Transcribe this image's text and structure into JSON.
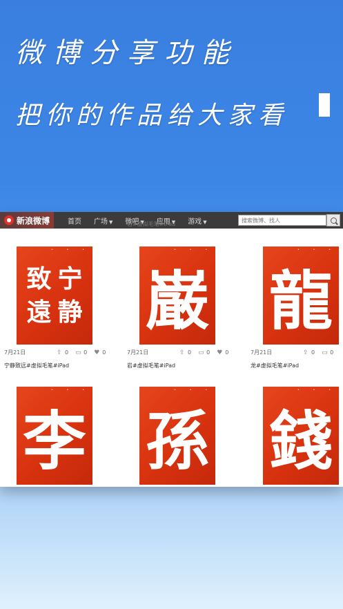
{
  "hero": {
    "headline": "微博分享功能",
    "subheadline": "把你的作品给大家看"
  },
  "weibo": {
    "logo_text": "新浪微博",
    "nav": [
      {
        "label": "首页",
        "has_caret": false
      },
      {
        "label": "广场",
        "has_caret": true
      },
      {
        "label": "微吧",
        "has_caret": true
      },
      {
        "label": "应用",
        "has_caret": true
      },
      {
        "label": "游戏",
        "has_caret": true
      }
    ],
    "search_placeholder": "搜索微博、找人",
    "ghost_text": "岩#虚拟毛笔#iPad"
  },
  "posts": [
    {
      "glyph": [
        "致",
        "宁",
        "遠",
        "静"
      ],
      "date": "7月21日",
      "share_count": "0",
      "comment_count": "0",
      "like_count": "0",
      "caption": "宁静致远#虚拟毛笔#iPad"
    },
    {
      "glyph": [
        "巌"
      ],
      "date": "7月21日",
      "share_count": "0",
      "comment_count": "0",
      "like_count": "0",
      "caption": "岩#虚拟毛笔#iPad"
    },
    {
      "glyph": [
        "龍"
      ],
      "date": "7月21日",
      "share_count": "0",
      "comment_count": "0",
      "like_count": "0",
      "caption": "龙#虚拟毛笔#iPad"
    },
    {
      "glyph": [
        "李"
      ]
    },
    {
      "glyph": [
        "孫"
      ]
    },
    {
      "glyph": [
        "錢"
      ]
    }
  ],
  "colors": {
    "artwork_red": "#d8320f",
    "topbar": "#3b3b3b",
    "sky_blue": "#3c86e6"
  },
  "icons": {
    "share": "share-icon",
    "comment": "comment-icon",
    "like": "heart-icon",
    "search": "search-icon"
  }
}
